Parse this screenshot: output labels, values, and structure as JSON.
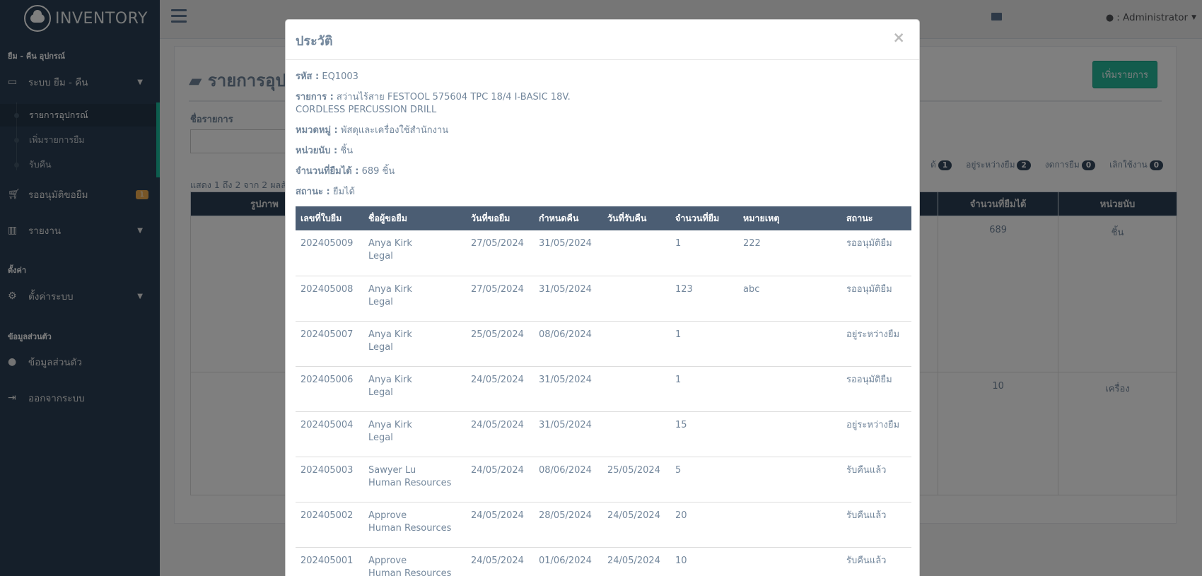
{
  "app": {
    "brand": "INVENTORY"
  },
  "sidebar": {
    "section_borrow": "ยืม - คืน อุปกรณ์",
    "menu_borrow_system": "ระบบ ยืม - คืน",
    "sub_items": [
      "รายการอุปกรณ์",
      "เพิ่มรายการยืม",
      "รับคืน"
    ],
    "menu_pending": "รออนุมัติขอยืม",
    "pending_badge": "1",
    "menu_report": "รายงาน",
    "section_settings": "ตั้งค่า",
    "menu_settings": "ตั้งค่าระบบ",
    "section_profile": "ข้อมูลส่วนตัว",
    "menu_profile": "ข้อมูลส่วนตัว",
    "menu_logout": "ออกจากระบบ"
  },
  "topnav": {
    "user": ": Administrator"
  },
  "background": {
    "title": "รายการอุป",
    "add_button": "เพิ่มรายการ",
    "search_label": "ชื่อรายการ",
    "filters": [
      {
        "label": "ด้",
        "count": "1"
      },
      {
        "label": "อยู่ระหว่างยืม",
        "count": "2"
      },
      {
        "label": "งดการยืม",
        "count": "0"
      },
      {
        "label": "เลิกใช้งาน",
        "count": "0"
      }
    ],
    "showing": "แสดง 1 ถึง 2 จาก 2 ผลลั",
    "headers": {
      "image": "รูปภาพ",
      "available": "จำนวนที่ยืมได้",
      "unit": "หน่วยนับ"
    },
    "rows": [
      {
        "available": "689",
        "unit": "ชิ้น"
      },
      {
        "available": "10",
        "unit": "เครื่อง"
      }
    ]
  },
  "modal": {
    "title": "ประวัติ",
    "close": "×",
    "code_label": "รหัส :",
    "code": "EQ1003",
    "item_label": "รายการ :",
    "item_line1": "สว่านไร้สาย FESTOOL 575604 TPC 18/4 I-BASIC 18V.",
    "item_line2": "CORDLESS PERCUSSION DRILL",
    "category_label": "หมวดหมู่ :",
    "category": "พัสดุและเครื่องใช้สำนักงาน",
    "unit_label": "หน่วยนับ :",
    "unit": "ชิ้น",
    "available_label": "จำนวนที่ยืมได้ :",
    "available": "689 ชิ้น",
    "status_label": "สถานะ :",
    "status": "ยืมได้",
    "table_headers": [
      "เลขที่ใบยืม",
      "ชื่อผู้ขอยืม",
      "วันที่ขอยืม",
      "กำหนดคืน",
      "วันที่รับคืน",
      "จำนวนที่ยืม",
      "หมายเหตุ",
      "สถานะ"
    ],
    "rows": [
      {
        "no": "202405009",
        "name": "Anya Kirk",
        "dept": "Legal",
        "req": "27/05/2024",
        "due": "31/05/2024",
        "ret": "",
        "qty": "1",
        "note": "222",
        "status": "รออนุมัติยืม"
      },
      {
        "no": "202405008",
        "name": "Anya Kirk",
        "dept": "Legal",
        "req": "27/05/2024",
        "due": "31/05/2024",
        "ret": "",
        "qty": "123",
        "note": "abc",
        "status": "รออนุมัติยืม"
      },
      {
        "no": "202405007",
        "name": "Anya Kirk",
        "dept": "Legal",
        "req": "25/05/2024",
        "due": "08/06/2024",
        "ret": "",
        "qty": "1",
        "note": "",
        "status": "อยู่ระหว่างยืม"
      },
      {
        "no": "202405006",
        "name": "Anya Kirk",
        "dept": "Legal",
        "req": "24/05/2024",
        "due": "31/05/2024",
        "ret": "",
        "qty": "1",
        "note": "",
        "status": "รออนุมัติยืม"
      },
      {
        "no": "202405004",
        "name": "Anya Kirk",
        "dept": "Legal",
        "req": "24/05/2024",
        "due": "31/05/2024",
        "ret": "",
        "qty": "15",
        "note": "",
        "status": "อยู่ระหว่างยืม"
      },
      {
        "no": "202405003",
        "name": "Sawyer Lu",
        "dept": "Human Resources",
        "req": "24/05/2024",
        "due": "08/06/2024",
        "ret": "25/05/2024",
        "qty": "5",
        "note": "",
        "status": "รับคืนแล้ว"
      },
      {
        "no": "202405002",
        "name": "Approve",
        "dept": "Human Resources",
        "req": "24/05/2024",
        "due": "28/05/2024",
        "ret": "24/05/2024",
        "qty": "20",
        "note": "",
        "status": "รับคืนแล้ว"
      },
      {
        "no": "202405001",
        "name": "Approve",
        "dept": "Human Resources",
        "req": "24/05/2024",
        "due": "01/06/2024",
        "ret": "24/05/2024",
        "qty": "10",
        "note": "",
        "status": "รับคืนแล้ว"
      }
    ]
  }
}
